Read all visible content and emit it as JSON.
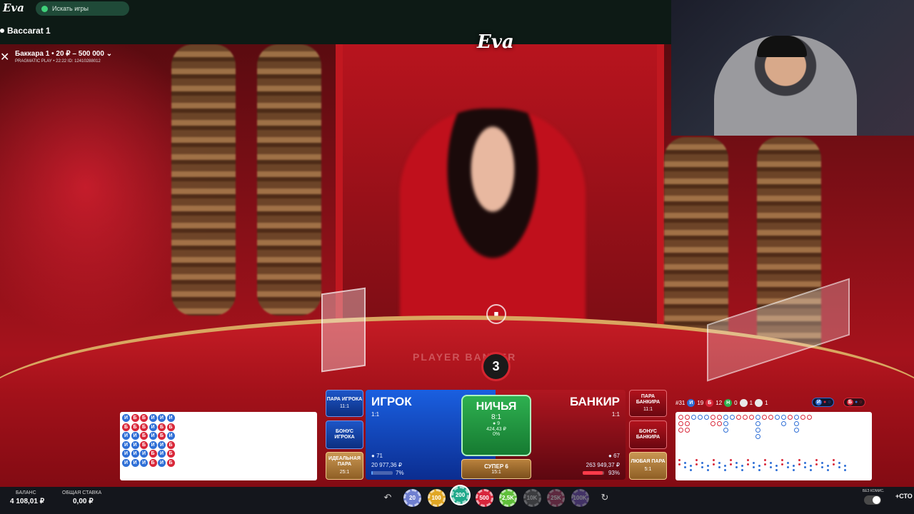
{
  "site": {
    "logo_small": "Eva",
    "logo_big": "Eva",
    "search_placeholder": "Искать игры",
    "game_title": "Baccarat 1"
  },
  "table": {
    "name": "Баккара 1 • 20 ₽ – 500 000",
    "provider_line": "PRAGMATIC PLAY • 22:22 ID: 12410288012",
    "close_glyph": "✕",
    "chevron_glyph": "⌄",
    "table_text": "PLAYER BANKER",
    "timer": "3",
    "video_glyph": "■"
  },
  "left_road": {
    "columns": [
      [
        "И",
        "Б",
        "И",
        "И",
        "И",
        "И"
      ],
      [
        "Б",
        "Б",
        "И",
        "И",
        "И",
        "И"
      ],
      [
        "Б",
        "Б",
        "Б",
        "Б",
        "И",
        "И"
      ],
      [
        "И",
        "И",
        "И",
        "И",
        "Б",
        "Б"
      ],
      [
        "И",
        "Б",
        "Б",
        "И",
        "И",
        "И"
      ],
      [
        "И",
        "Б",
        "И",
        "Б",
        "Б",
        "Б"
      ]
    ]
  },
  "bets": {
    "player_pair": {
      "label": "ПАРА ИГРОКА",
      "odds": "11:1"
    },
    "player_bonus": {
      "label": "БОНУС ИГРОКА"
    },
    "perfect_pair": {
      "label": "ИДЕАЛЬНАЯ ПАРА",
      "odds": "25:1"
    },
    "player": {
      "label": "ИГРОК",
      "odds": "1:1",
      "players": "71",
      "amount": "20 977,36 ₽",
      "percent": "7%",
      "percent_value": 7
    },
    "tie": {
      "label": "НИЧЬЯ",
      "odds": "8:1",
      "players": "9",
      "amount": "424,43 ₽",
      "percent": "0%"
    },
    "super6": {
      "label": "СУПЕР 6",
      "odds": "15:1"
    },
    "banker": {
      "label": "БАНКИР",
      "odds": "1:1",
      "players": "67",
      "amount": "263 949,37 ₽",
      "percent": "93%",
      "percent_value": 93
    },
    "banker_pair": {
      "label": "ПАРА БАНКИРА",
      "odds": "11:1"
    },
    "banker_bonus": {
      "label": "БОНУС БАНКИРА"
    },
    "any_pair": {
      "label": "ЛЮБАЯ ПАРА",
      "odds": "5:1"
    }
  },
  "stats": {
    "round": "#31",
    "player_letter": "И",
    "player_count": "19",
    "banker_letter": "Б",
    "banker_count": "12",
    "tie_letter": "Н",
    "tie_count": "0",
    "pair1_count": "1",
    "pair2_count": "1",
    "pred_player": "И",
    "pred_banker": "Б"
  },
  "bottom": {
    "balance_label": "БАЛАНС",
    "balance_value": "4 108,01 ₽",
    "total_bet_label": "ОБЩАЯ СТАВКА",
    "total_bet_value": "0,00 ₽",
    "undo_glyph": "↶",
    "repeat_glyph": "↻",
    "no_commission_label": "БЕЗ КОМИС.",
    "more_label": "+СТО"
  },
  "chips": [
    {
      "label": "20",
      "color": "#6f7fd0"
    },
    {
      "label": "100",
      "color": "#e0a623"
    },
    {
      "label": "200",
      "color": "#1fa88a"
    },
    {
      "label": "500",
      "color": "#d8263c"
    },
    {
      "label": "2,5K",
      "color": "#5fbf3a"
    },
    {
      "label": "10K",
      "color": "#6b6b6b"
    },
    {
      "label": "25K",
      "color": "#b7426b"
    },
    {
      "label": "100K",
      "color": "#7a55c0"
    }
  ],
  "colors": {
    "player_blue": "#1a5fe0",
    "banker_red": "#b01620",
    "tie_green": "#2eb050",
    "accent_gold": "#c99652"
  }
}
